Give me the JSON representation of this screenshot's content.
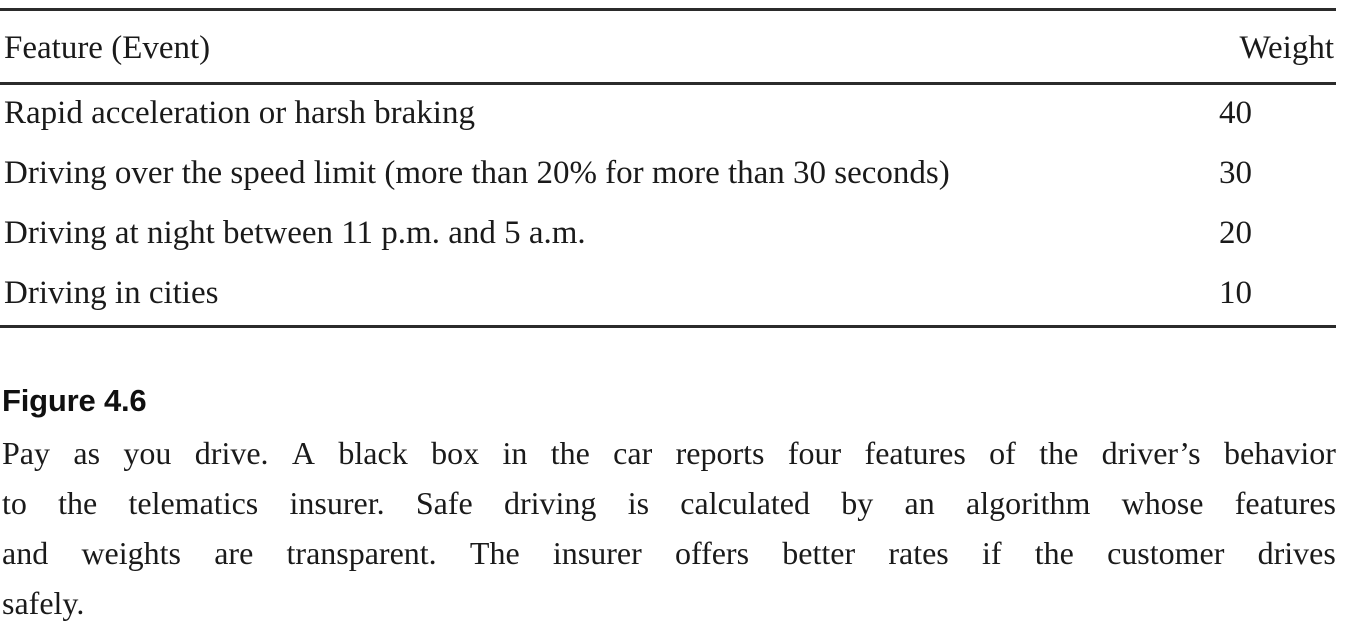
{
  "table": {
    "columns": [
      "Feature (Event)",
      "Weight"
    ],
    "rows": [
      {
        "feature": "Rapid acceleration or harsh braking",
        "weight": "40"
      },
      {
        "feature": "Driving over the speed limit (more than 20% for more than 30 seconds)",
        "weight": "30"
      },
      {
        "feature": "Driving at night between 11 p.m. and 5 a.m.",
        "weight": "20"
      },
      {
        "feature": "Driving in cities",
        "weight": "10"
      }
    ]
  },
  "caption": {
    "label": "Figure 4.6",
    "lines": [
      "Pay as you drive. A black box in the car reports four features of the driver’s behavior",
      "to the telematics insurer. Safe driving is calculated by an algorithm whose features",
      "and weights are transparent. The insurer offers better rates if the customer drives",
      "safely."
    ],
    "full_text": "Pay as you drive. A black box in the car reports four features of the driver’s behavior to the telematics insurer. Safe driving is calculated by an algorithm whose features and weights are transparent. The insurer offers better rates if the customer drives safely."
  },
  "colors": {
    "background": "#ffffff",
    "text": "#1a1a1a",
    "rule": "#2b2b2b"
  }
}
